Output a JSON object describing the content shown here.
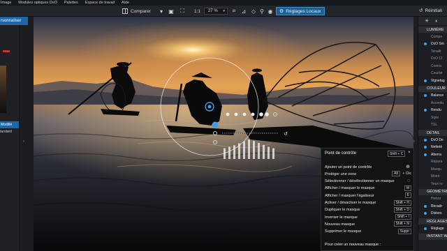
{
  "menubar": [
    "Image",
    "Modules optiques DxO",
    "Palettes",
    "Espace de travail",
    "Aide"
  ],
  "toolbar": {
    "compare_label": "Comparer",
    "zoom_ratio": "1:1",
    "zoom_percent": "27 %",
    "local_adjust_label": "Réglages Locaux",
    "reset_label": "Réinitiali"
  },
  "left_panel": {
    "header": "rsonnaliser",
    "modified_label": "Modifié",
    "standard_label": "tandard"
  },
  "right_panel": {
    "sections": [
      {
        "title": "LUMIÈRE",
        "items": [
          {
            "label": "Compe",
            "on": false
          },
          {
            "label": "DxO Sm",
            "on": true
          },
          {
            "label": "Tonalit",
            "on": false
          },
          {
            "label": "DxO Cl",
            "on": false
          },
          {
            "label": "Contra",
            "on": false
          },
          {
            "label": "Courbe",
            "on": false
          },
          {
            "label": "Vignetag",
            "on": true
          }
        ]
      },
      {
        "title": "COULEUR",
        "items": [
          {
            "label": "Balance",
            "on": true
          },
          {
            "label": "Accentu",
            "on": false
          },
          {
            "label": "Rendu",
            "on": true
          },
          {
            "label": "Style",
            "on": false
          },
          {
            "label": "TSL",
            "on": false
          }
        ]
      },
      {
        "title": "DÉTAIL",
        "items": [
          {
            "label": "DxO De",
            "on": true
          },
          {
            "label": "Netteté",
            "on": true
          },
          {
            "label": "Aberra",
            "on": true
          },
          {
            "label": "Répara",
            "on": false
          },
          {
            "label": "Masqu",
            "on": false
          },
          {
            "label": "Moiré",
            "on": false
          },
          {
            "label": "Yeux ro",
            "on": false
          }
        ]
      },
      {
        "title": "GÉOMÉTRIE",
        "items": [
          {
            "label": "Horizo",
            "on": false
          },
          {
            "label": "Recadr",
            "on": true
          },
          {
            "label": "Distors",
            "on": true
          }
        ]
      },
      {
        "title": "RÉGLAGES",
        "items": [
          {
            "label": "Réglage",
            "on": true
          }
        ]
      },
      {
        "title": "INSTANT W",
        "items": []
      }
    ]
  },
  "context_menu": {
    "title": "Point de contrôle",
    "title_shortcut": "Shift + C",
    "items": [
      {
        "label": "Ajouter un point de contrôle",
        "shortcut": "",
        "icon": "target-icon"
      },
      {
        "label": "Protéger une zone",
        "shortcut": "Alt",
        "suffix": "+ Clic"
      },
      {
        "label": "Sélectionner / désélectionner un masque",
        "shortcut": "",
        "icon": "lasso-icon"
      },
      {
        "label": "Afficher / masquer le masque",
        "shortcut": "M"
      },
      {
        "label": "Afficher / masquer l'égaliseur",
        "shortcut": "E"
      },
      {
        "label": "Activer / désactiver le masque",
        "shortcut": "Shift + H"
      },
      {
        "label": "Dupliquer le masque",
        "shortcut": "Shift + D"
      },
      {
        "label": "Inverser le masque",
        "shortcut": "Shift + I"
      },
      {
        "label": "Nouveau masque",
        "shortcut": "Shift + N"
      },
      {
        "label": "Supprimer le masque",
        "shortcut": "Suppr"
      }
    ],
    "footer": "Pour créer un nouveau masque :"
  },
  "colors": {
    "accent": "#1d66a8",
    "local_adjust_bg": "#1f5f93",
    "panel_bg": "#1c1e21",
    "menu_bg": "#121315"
  },
  "equalizer_levels": [
    0.55,
    0.62,
    0.7,
    0.8,
    0.9,
    1.0,
    0.92,
    0.82,
    0.72,
    0.62,
    0.55
  ]
}
